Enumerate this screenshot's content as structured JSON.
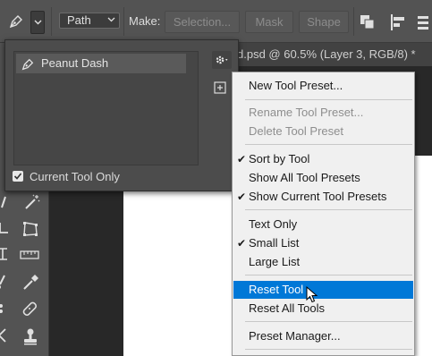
{
  "options_bar": {
    "mode_value": "Path",
    "make_label": "Make:",
    "selection_button": "Selection...",
    "mask_button": "Mask",
    "shape_button": "Shape"
  },
  "document": {
    "tab_title": "d.psd @ 60.5% (Layer 3, RGB/8) *"
  },
  "preset_panel": {
    "items": [
      {
        "label": "Peanut Dash",
        "icon": "pen-tool-icon"
      }
    ],
    "current_tool_only_label": "Current Tool Only",
    "current_tool_only_checked": true
  },
  "menu": {
    "new_tool_preset": "New Tool Preset...",
    "rename_tool_preset": "Rename Tool Preset...",
    "delete_tool_preset": "Delete Tool Preset",
    "sort_by_tool": "Sort by Tool",
    "show_all_tool_presets": "Show All Tool Presets",
    "show_current_tool_presets": "Show Current Tool Presets",
    "text_only": "Text Only",
    "small_list": "Small List",
    "large_list": "Large List",
    "reset_tool": "Reset Tool",
    "reset_all_tools": "Reset All Tools",
    "preset_manager": "Preset Manager..."
  },
  "colors": {
    "highlight": "#0078d7",
    "menu_bg": "#f0f0f0",
    "panel_bg": "#4c4c4c",
    "ui_bg": "#535353"
  }
}
